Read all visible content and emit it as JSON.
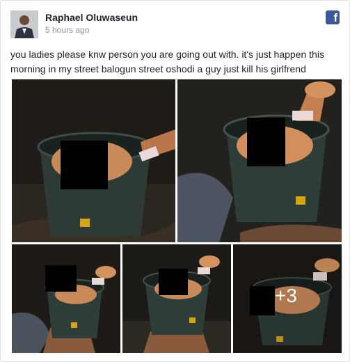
{
  "post": {
    "author": "Raphael Oluwaseun",
    "timestamp": "5 hours ago",
    "text": "you ladies please knw person you are going out with. it's just happen this morning in my street balogun street oshodi a guy just kill his girlfrend"
  },
  "brand": {
    "logo_icon": "facebook-icon",
    "color": "#3b5998",
    "glyph": "f"
  },
  "photos": {
    "more_count": "+3"
  },
  "colors": {
    "author": "#1d2129",
    "timestamp": "#90949c",
    "border": "#dddfe2"
  }
}
